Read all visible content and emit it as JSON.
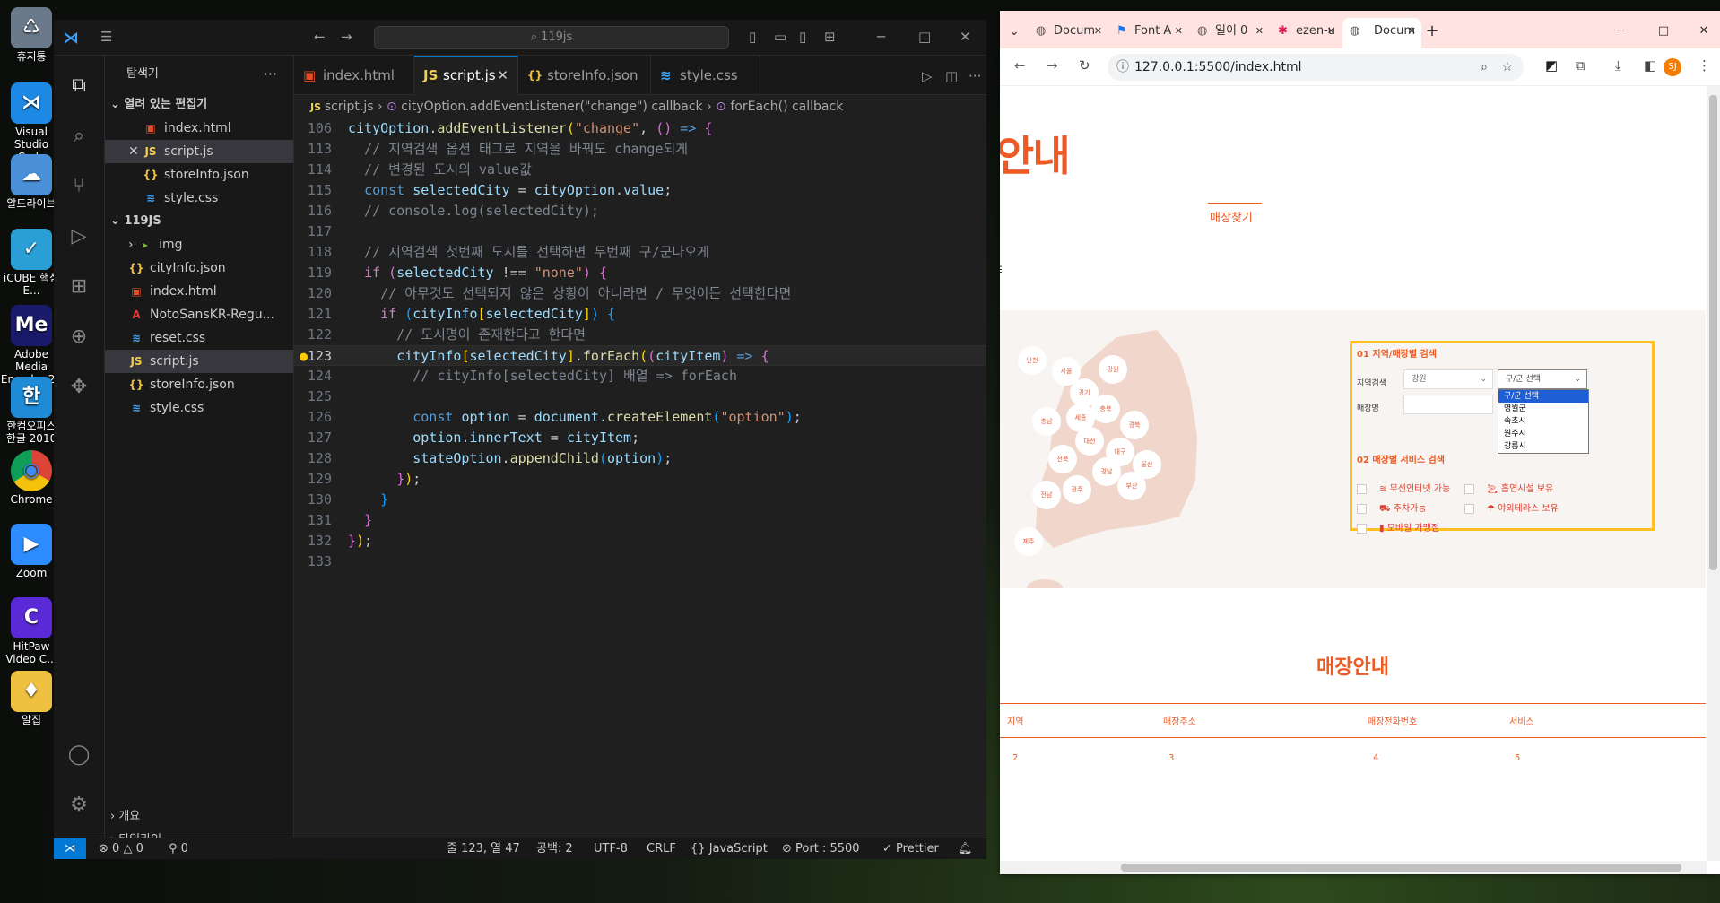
{
  "desktop": {
    "icons": [
      {
        "label": "휴지통",
        "icon": "recycle-bin-icon",
        "color": "#6a7a8a"
      },
      {
        "label": "Visual Studio Code",
        "icon": "vscode-icon",
        "color": "#1e88e5"
      },
      {
        "label": "알드라이브",
        "icon": "aldrive-icon",
        "color": "#4a90d9"
      },
      {
        "label": "iCUBE 핵심E...",
        "icon": "icube-icon",
        "color": "#2a9fd6"
      },
      {
        "label": "Adobe Media Encoder 20",
        "icon": "adobe-me-icon",
        "color": "#1a1a6a"
      },
      {
        "label": "한컴오피스 한글 2010",
        "icon": "hancom-icon",
        "color": "#1f8ad6"
      },
      {
        "label": "Chrome",
        "icon": "chrome-icon",
        "color": "#ffffff"
      },
      {
        "label": "Zoom",
        "icon": "zoom-icon",
        "color": "#2d8cff"
      },
      {
        "label": "HitPaw Video C...",
        "icon": "hitpaw-icon",
        "color": "#5a2ad6"
      },
      {
        "label": "알집",
        "icon": "alzip-icon",
        "color": "#f0c040"
      }
    ]
  },
  "vscode": {
    "search_text": "119js",
    "explorer_title": "탐색기",
    "open_editors_label": "열려 있는 편집기",
    "open_editors": [
      {
        "name": "index.html",
        "type": "html"
      },
      {
        "name": "script.js",
        "type": "js"
      },
      {
        "name": "storeInfo.json",
        "type": "json"
      },
      {
        "name": "style.css",
        "type": "css"
      }
    ],
    "project_label": "119JS",
    "files": [
      {
        "name": "img",
        "type": "folder"
      },
      {
        "name": "cityInfo.json",
        "type": "json"
      },
      {
        "name": "index.html",
        "type": "html"
      },
      {
        "name": "NotoSansKR-Regu...",
        "type": "font"
      },
      {
        "name": "reset.css",
        "type": "css"
      },
      {
        "name": "script.js",
        "type": "js"
      },
      {
        "name": "storeInfo.json",
        "type": "json"
      },
      {
        "name": "style.css",
        "type": "css"
      }
    ],
    "outline_label": "개요",
    "timeline_label": "타임라인",
    "tabs": [
      "index.html",
      "script.js",
      "storeInfo.json",
      "style.css"
    ],
    "breadcrumb": [
      "script.js",
      "cityOption.addEventListener(\"change\") callback",
      "forEach() callback"
    ],
    "line_numbers": [
      "106",
      "113",
      "114",
      "115",
      "116",
      "117",
      "118",
      "119",
      "120",
      "121",
      "122",
      "123",
      "124",
      "125",
      "126",
      "127",
      "128",
      "129",
      "130",
      "131",
      "132",
      "133"
    ],
    "current_line": "123",
    "status": {
      "errors": "0",
      "warnings": "0",
      "ports": "0",
      "position": "줄 123, 열 47",
      "spaces": "공백: 2",
      "encoding": "UTF-8",
      "eol": "CRLF",
      "language": "JavaScript",
      "port": "Port : 5500",
      "formatter": "Prettier"
    }
  },
  "browser": {
    "tabs": [
      "Docum",
      "Font A",
      "일이 0",
      "ezen-u",
      "Docum"
    ],
    "url": "127.0.0.1:5500/index.html",
    "profile_initials": "SJ",
    "page": {
      "hero_title": "안내",
      "find_store_tab": "매장찾기",
      "section1_title": "01 지역/매장별 검색",
      "region_label": "지역검색",
      "region_value": "강원",
      "district_value": "구/군 선택",
      "district_options": [
        "구/군 선택",
        "영월군",
        "속초시",
        "원주시",
        "강릉시"
      ],
      "store_name_label": "매장명",
      "section2_title": "02 매장별 서비스 검색",
      "services": [
        "무선인터넷 가능",
        "흡연시설 보유",
        "주차가능",
        "야외테라스 보유",
        "모바일 가맹점"
      ],
      "cities": [
        "인천",
        "서울",
        "강원",
        "경기",
        "충북",
        "충남",
        "세종",
        "경북",
        "대전",
        "대구",
        "전북",
        "울산",
        "경남",
        "광주",
        "부산",
        "전남",
        "제주"
      ],
      "list_title": "매장안내",
      "table_headers": [
        "지역",
        "매장주소",
        "매장전화번호",
        "서비스"
      ],
      "table_row": [
        "2",
        "3",
        "4",
        "5"
      ]
    }
  },
  "colors": {
    "accent": "#ee5a24",
    "highlight_border": "#ffbf1f",
    "vscode_blue": "#0078d4"
  }
}
